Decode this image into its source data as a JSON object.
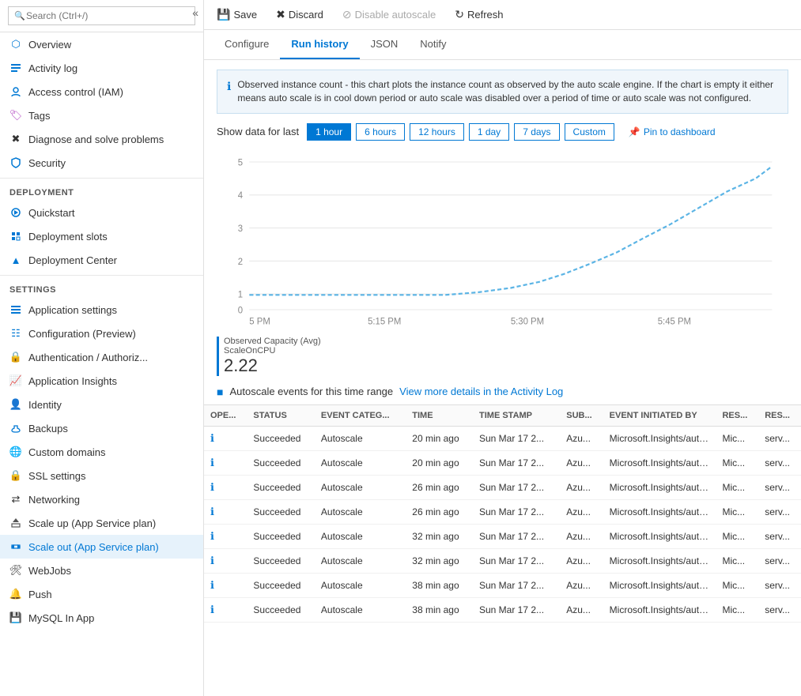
{
  "sidebar": {
    "search_placeholder": "Search (Ctrl+/)",
    "items": [
      {
        "id": "overview",
        "label": "Overview",
        "icon": "overview",
        "section": ""
      },
      {
        "id": "activity-log",
        "label": "Activity log",
        "icon": "activitylog",
        "section": ""
      },
      {
        "id": "access-control",
        "label": "Access control (IAM)",
        "icon": "access",
        "section": ""
      },
      {
        "id": "tags",
        "label": "Tags",
        "icon": "tags",
        "section": ""
      },
      {
        "id": "diagnose",
        "label": "Diagnose and solve problems",
        "icon": "diagnose",
        "section": ""
      },
      {
        "id": "security",
        "label": "Security",
        "icon": "security",
        "section": ""
      }
    ],
    "sections": [
      {
        "label": "Deployment",
        "items": [
          {
            "id": "quickstart",
            "label": "Quickstart",
            "icon": "quickstart"
          },
          {
            "id": "deployment-slots",
            "label": "Deployment slots",
            "icon": "depslots"
          },
          {
            "id": "deployment-center",
            "label": "Deployment Center",
            "icon": "depcenter"
          }
        ]
      },
      {
        "label": "Settings",
        "items": [
          {
            "id": "app-settings",
            "label": "Application settings",
            "icon": "appsettings"
          },
          {
            "id": "configuration",
            "label": "Configuration (Preview)",
            "icon": "config"
          },
          {
            "id": "auth",
            "label": "Authentication / Authoriz...",
            "icon": "auth"
          },
          {
            "id": "app-insights",
            "label": "Application Insights",
            "icon": "appinsights"
          },
          {
            "id": "identity",
            "label": "Identity",
            "icon": "identity"
          },
          {
            "id": "backups",
            "label": "Backups",
            "icon": "backups"
          },
          {
            "id": "custom-domains",
            "label": "Custom domains",
            "icon": "customdomains"
          },
          {
            "id": "ssl-settings",
            "label": "SSL settings",
            "icon": "ssl"
          },
          {
            "id": "networking",
            "label": "Networking",
            "icon": "networking"
          },
          {
            "id": "scale-up",
            "label": "Scale up (App Service plan)",
            "icon": "scaleup"
          },
          {
            "id": "scale-out",
            "label": "Scale out (App Service plan)",
            "icon": "scaleout",
            "active": true
          },
          {
            "id": "webjobs",
            "label": "WebJobs",
            "icon": "webjobs"
          },
          {
            "id": "push",
            "label": "Push",
            "icon": "push"
          },
          {
            "id": "mysql",
            "label": "MySQL In App",
            "icon": "mysql"
          }
        ]
      }
    ]
  },
  "toolbar": {
    "save_label": "Save",
    "discard_label": "Discard",
    "disable_autoscale_label": "Disable autoscale",
    "refresh_label": "Refresh"
  },
  "tabs": [
    "Configure",
    "Run history",
    "JSON",
    "Notify"
  ],
  "active_tab": "Run history",
  "info": {
    "text": "Observed instance count - this chart plots the instance count as observed by the auto scale engine. If the chart is empty it either means auto scale is in cool down period or auto scale was disabled over a period of time or auto scale was not configured."
  },
  "time_filter": {
    "label": "Show data for last",
    "options": [
      "1 hour",
      "6 hours",
      "12 hours",
      "1 day",
      "7 days",
      "Custom"
    ],
    "active": "1 hour",
    "pin_label": "Pin to dashboard"
  },
  "chart": {
    "x_labels": [
      "5 PM",
      "5:15 PM",
      "5:30 PM",
      "5:45 PM"
    ],
    "y_labels": [
      "0",
      "1",
      "2",
      "3",
      "4",
      "5"
    ],
    "legend_title": "Observed Capacity (Avg)",
    "legend_sub": "ScaleOnCPU",
    "legend_value": "2.22",
    "points": [
      [
        0,
        1
      ],
      [
        15,
        1
      ],
      [
        30,
        1
      ],
      [
        45,
        1
      ],
      [
        60,
        1
      ],
      [
        75,
        1
      ],
      [
        90,
        1
      ],
      [
        105,
        1.1
      ],
      [
        120,
        1.3
      ],
      [
        135,
        1.6
      ],
      [
        150,
        2.0
      ],
      [
        165,
        2.5
      ],
      [
        180,
        3.1
      ],
      [
        195,
        3.7
      ],
      [
        210,
        4.2
      ],
      [
        225,
        4.7
      ],
      [
        240,
        5.0
      ],
      [
        255,
        5.0
      ],
      [
        270,
        5.0
      ],
      [
        285,
        5.0
      ]
    ]
  },
  "autoscale_events": {
    "header": "Autoscale events for this time range",
    "link_text": "View more details in the Activity Log",
    "columns": [
      "OPE...",
      "STATUS",
      "EVENT CATEG...",
      "TIME",
      "TIME STAMP",
      "SUB...",
      "EVENT INITIATED BY",
      "RES...",
      "RES..."
    ],
    "rows": [
      {
        "status": "Succeeded",
        "category": "Autoscale",
        "time": "20 min ago",
        "timestamp": "Sun Mar 17 2...",
        "sub": "Azu...",
        "initiated": "Microsoft.Insights/autoscale...",
        "res1": "Mic...",
        "res2": "serv..."
      },
      {
        "status": "Succeeded",
        "category": "Autoscale",
        "time": "20 min ago",
        "timestamp": "Sun Mar 17 2...",
        "sub": "Azu...",
        "initiated": "Microsoft.Insights/autoscale...",
        "res1": "Mic...",
        "res2": "serv..."
      },
      {
        "status": "Succeeded",
        "category": "Autoscale",
        "time": "26 min ago",
        "timestamp": "Sun Mar 17 2...",
        "sub": "Azu...",
        "initiated": "Microsoft.Insights/autoscale...",
        "res1": "Mic...",
        "res2": "serv..."
      },
      {
        "status": "Succeeded",
        "category": "Autoscale",
        "time": "26 min ago",
        "timestamp": "Sun Mar 17 2...",
        "sub": "Azu...",
        "initiated": "Microsoft.Insights/autoscale...",
        "res1": "Mic...",
        "res2": "serv..."
      },
      {
        "status": "Succeeded",
        "category": "Autoscale",
        "time": "32 min ago",
        "timestamp": "Sun Mar 17 2...",
        "sub": "Azu...",
        "initiated": "Microsoft.Insights/autoscale...",
        "res1": "Mic...",
        "res2": "serv..."
      },
      {
        "status": "Succeeded",
        "category": "Autoscale",
        "time": "32 min ago",
        "timestamp": "Sun Mar 17 2...",
        "sub": "Azu...",
        "initiated": "Microsoft.Insights/autoscale...",
        "res1": "Mic...",
        "res2": "serv..."
      },
      {
        "status": "Succeeded",
        "category": "Autoscale",
        "time": "38 min ago",
        "timestamp": "Sun Mar 17 2...",
        "sub": "Azu...",
        "initiated": "Microsoft.Insights/autoscale...",
        "res1": "Mic...",
        "res2": "serv..."
      },
      {
        "status": "Succeeded",
        "category": "Autoscale",
        "time": "38 min ago",
        "timestamp": "Sun Mar 17 2...",
        "sub": "Azu...",
        "initiated": "Microsoft.Insights/autoscale...",
        "res1": "Mic...",
        "res2": "serv..."
      }
    ]
  }
}
